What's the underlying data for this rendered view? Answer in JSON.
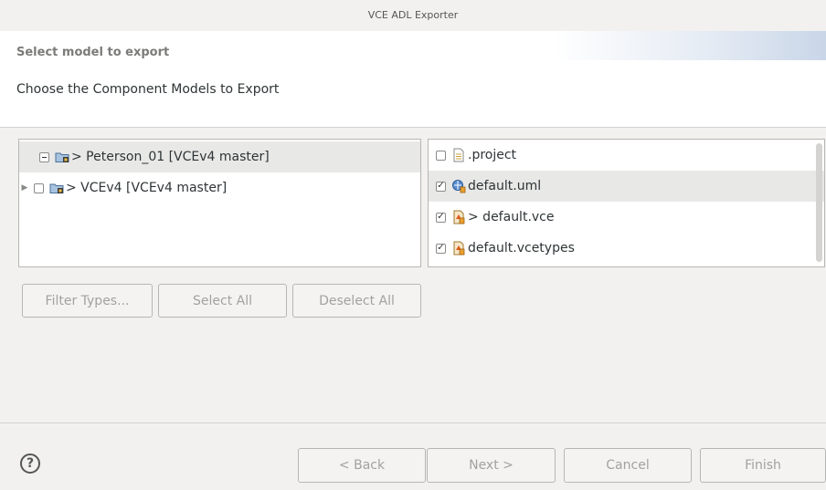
{
  "window": {
    "title": "VCE ADL Exporter"
  },
  "wizard": {
    "title": "Select model to export",
    "description": "Choose the Component Models to Export"
  },
  "tree": {
    "items": [
      {
        "label": "> Peterson_01  [VCEv4 master]",
        "state": "partial",
        "expanded": true,
        "selected": true,
        "icon": "project-folder-icon"
      },
      {
        "label": "> VCEv4  [VCEv4 master]",
        "state": "unchecked",
        "expanded": false,
        "selected": false,
        "icon": "project-folder-icon"
      }
    ]
  },
  "files": {
    "items": [
      {
        "label": ".project",
        "checked": false,
        "icon": "text-file-icon"
      },
      {
        "label": "default.uml",
        "checked": true,
        "selected": true,
        "icon": "uml-file-icon"
      },
      {
        "label": "> default.vce",
        "checked": true,
        "icon": "vce-file-icon"
      },
      {
        "label": "default.vcetypes",
        "checked": true,
        "icon": "vce-file-icon"
      }
    ]
  },
  "buttons": {
    "filter_types": "Filter Types...",
    "select_all": "Select All",
    "deselect_all": "Deselect All",
    "back": "< Back",
    "next": "Next >",
    "cancel": "Cancel",
    "finish": "Finish",
    "help": "?"
  }
}
